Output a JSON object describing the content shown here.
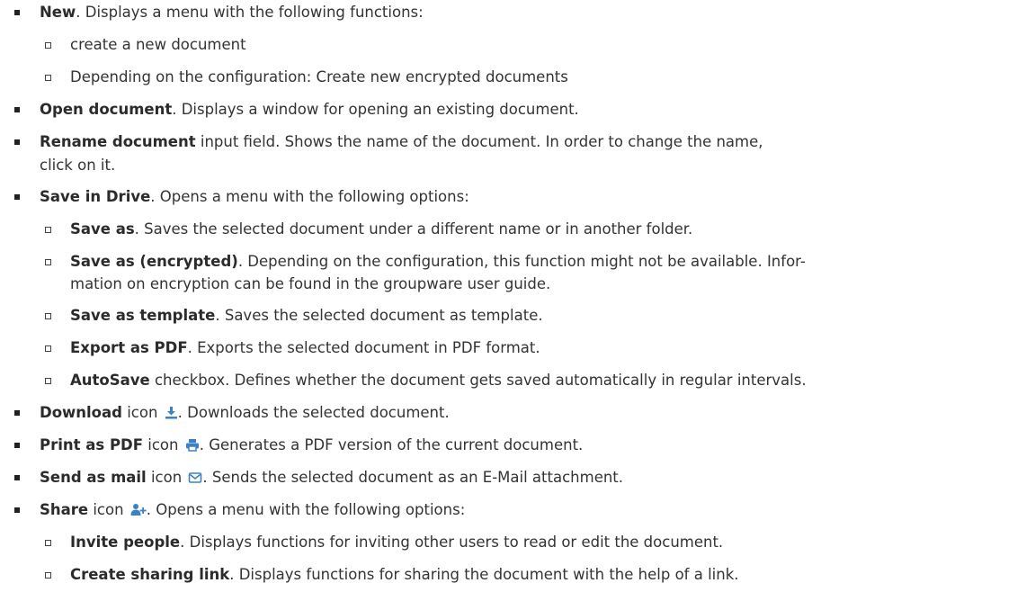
{
  "items": [
    {
      "level": 1,
      "bold": "New",
      "text": ". Displays a menu with the following functions:"
    },
    {
      "level": 2,
      "bold": "",
      "text": "create a new document"
    },
    {
      "level": 2,
      "bold": "",
      "text": "Depending on the configuration: Create new encrypted documents"
    },
    {
      "level": 1,
      "bold": "Open document",
      "text": ". Displays a window for opening an existing document."
    },
    {
      "level": 1,
      "bold": "Rename document",
      "text": " input field. Shows the name of the document. In order to change the name,",
      "text2": "click on it."
    },
    {
      "level": 1,
      "bold": "Save in Drive",
      "text": ". Opens a menu with the following options:"
    },
    {
      "level": 2,
      "bold": "Save as",
      "text": ". Saves the selected document under a different name or in another folder."
    },
    {
      "level": 2,
      "bold": "Save as (encrypted)",
      "text": ". Depending on the configuration, this function might not be available. Infor-",
      "text2": "mation on encryption can be found in the groupware user guide."
    },
    {
      "level": 2,
      "bold": "Save as template",
      "text": ". Saves the selected document as template."
    },
    {
      "level": 2,
      "bold": "Export as PDF",
      "text": ". Exports the selected document in PDF format."
    },
    {
      "level": 2,
      "bold": "AutoSave",
      "text": " checkbox. Defines whether the document gets saved automatically in regular intervals."
    },
    {
      "level": 1,
      "bold": "Download",
      "pre_icon": " icon ",
      "icon": "download-icon",
      "text": ". Downloads the selected document."
    },
    {
      "level": 1,
      "bold": "Print as PDF",
      "pre_icon": " icon ",
      "icon": "print-icon",
      "text": ". Generates a PDF version of the current document."
    },
    {
      "level": 1,
      "bold": "Send as mail",
      "pre_icon": " icon ",
      "icon": "mail-icon",
      "text": ". Sends the selected document as an E-Mail attachment."
    },
    {
      "level": 1,
      "bold": "Share",
      "pre_icon": " icon ",
      "icon": "share-icon",
      "text": ". Opens a menu with the following options:"
    },
    {
      "level": 2,
      "bold": "Invite people",
      "text": ". Displays functions for inviting other users to read or edit the document."
    },
    {
      "level": 2,
      "bold": "Create sharing link",
      "text": ". Displays functions for sharing the document with the help of a link."
    }
  ],
  "icon_color": "#3b82c4"
}
